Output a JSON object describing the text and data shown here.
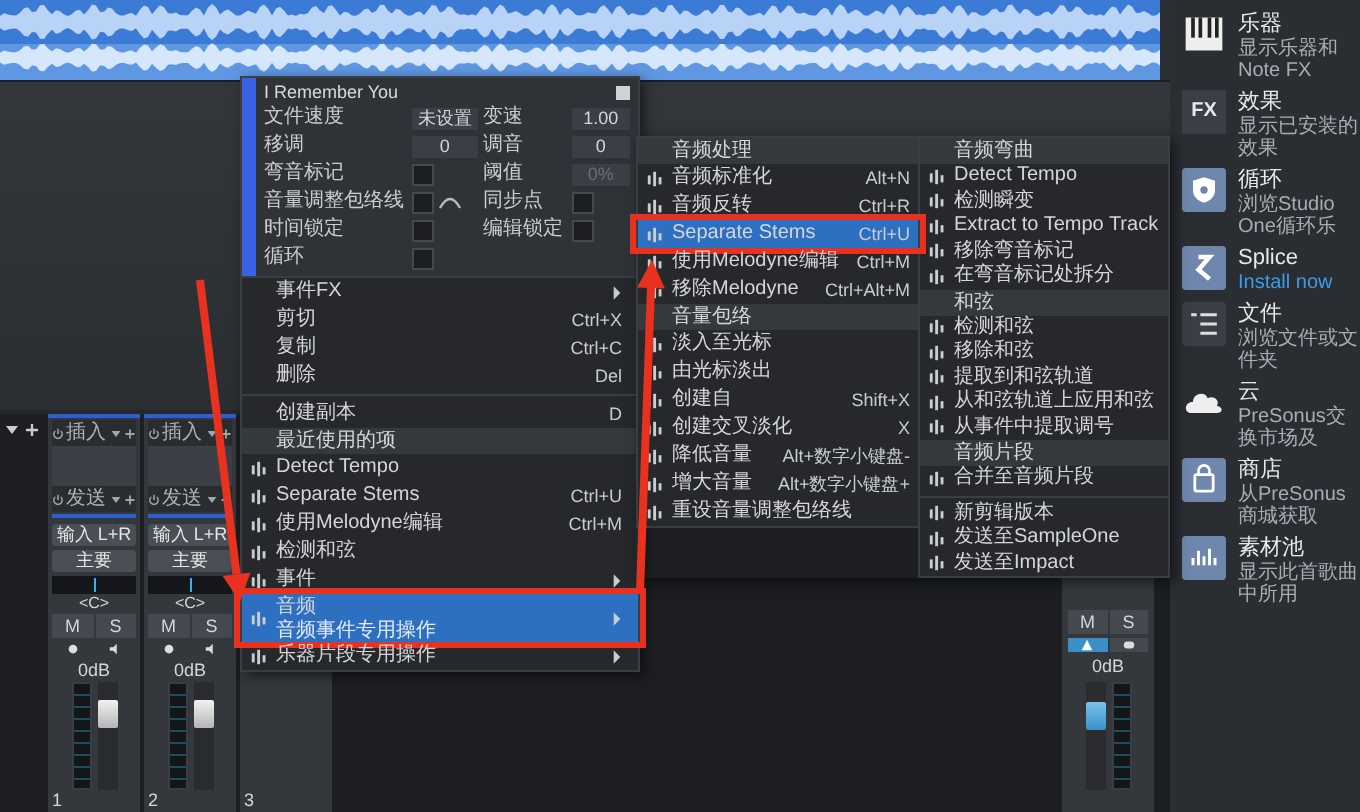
{
  "mixer": {
    "channels": [
      {
        "insert_label": "插入",
        "send_label": "发送",
        "input": "输入 L+R",
        "output": "主要",
        "pan": "<C>",
        "mute": "M",
        "solo": "S",
        "volume": "0dB",
        "level": 0.72,
        "number": "1"
      },
      {
        "insert_label": "插入",
        "send_label": "发送",
        "input": "输入 L+R",
        "output": "主要",
        "pan": "<C>",
        "mute": "M",
        "solo": "S",
        "volume": "0dB",
        "level": 0.72,
        "number": "2"
      },
      {
        "number": "3"
      }
    ],
    "right_channel": {
      "mute": "M",
      "solo": "S",
      "monitor_on": true,
      "volume": "0dB",
      "level": 0.7
    }
  },
  "event_menu": {
    "title": "I Remember You",
    "properties": [
      {
        "label": "文件速度",
        "kind": "value",
        "value": "未设置",
        "disabled": false
      },
      {
        "label": "变速",
        "kind": "value",
        "value": "1.00",
        "disabled": false
      },
      {
        "label": "移调",
        "kind": "value",
        "value": "0",
        "disabled": false
      },
      {
        "label": "调音",
        "kind": "value",
        "value": "0",
        "disabled": false
      },
      {
        "label": "弯音标记",
        "kind": "check",
        "checked": false
      },
      {
        "label": "阈值",
        "kind": "value",
        "value": "0%",
        "disabled": true
      },
      {
        "label": "音量调整包络线",
        "kind": "check_curve",
        "checked": false
      },
      {
        "label": "同步点",
        "kind": "check",
        "checked": false
      },
      {
        "label": "时间锁定",
        "kind": "check",
        "checked": false
      },
      {
        "label": "编辑锁定",
        "kind": "check",
        "checked": false
      },
      {
        "label": "循环",
        "kind": "check",
        "checked": false
      }
    ],
    "items": [
      {
        "kind": "item",
        "label": "事件FX",
        "submenu": true,
        "has_icon": false,
        "selected": false,
        "framed": false
      },
      {
        "kind": "item",
        "label": "剪切",
        "shortcut": "Ctrl+X",
        "submenu": false,
        "has_icon": false,
        "selected": false,
        "framed": false
      },
      {
        "kind": "item",
        "label": "复制",
        "shortcut": "Ctrl+C",
        "submenu": false,
        "has_icon": false,
        "selected": false,
        "framed": false
      },
      {
        "kind": "item",
        "label": "删除",
        "shortcut": "Del",
        "submenu": false,
        "has_icon": false,
        "selected": false,
        "framed": false
      },
      {
        "kind": "separator"
      },
      {
        "kind": "item",
        "label": "创建副本",
        "shortcut": "D",
        "submenu": false,
        "has_icon": false,
        "selected": false,
        "framed": false
      },
      {
        "kind": "section",
        "label": "最近使用的项"
      },
      {
        "kind": "item",
        "label": "Detect Tempo",
        "submenu": false,
        "has_icon": true,
        "selected": false,
        "framed": false
      },
      {
        "kind": "item",
        "label": "Separate Stems",
        "shortcut": "Ctrl+U",
        "submenu": false,
        "has_icon": true,
        "selected": false,
        "framed": false
      },
      {
        "kind": "item",
        "label": "使用Melodyne编辑",
        "shortcut": "Ctrl+M",
        "submenu": false,
        "has_icon": true,
        "selected": false,
        "framed": false
      },
      {
        "kind": "item",
        "label": "检测和弦",
        "submenu": false,
        "has_icon": true,
        "selected": false,
        "framed": false
      },
      {
        "kind": "item",
        "label": "事件",
        "submenu": true,
        "has_icon": true,
        "selected": false,
        "framed": false
      },
      {
        "kind": "item",
        "label": "音频",
        "subtitle": "音频事件专用操作",
        "submenu": true,
        "has_icon": true,
        "selected": true,
        "framed": true
      },
      {
        "kind": "item",
        "label": "乐器片段专用操作",
        "submenu": true,
        "has_icon": true,
        "selected": false,
        "framed": false
      }
    ]
  },
  "audio_submenu": {
    "columns": [
      [
        {
          "kind": "section",
          "label": "音频处理"
        },
        {
          "kind": "item",
          "label": "音频标准化",
          "shortcut": "Alt+N",
          "has_icon": true,
          "selected": false,
          "framed": false
        },
        {
          "kind": "item",
          "label": "音频反转",
          "shortcut": "Ctrl+R",
          "has_icon": true,
          "selected": false,
          "framed": false
        },
        {
          "kind": "item",
          "label": "Separate Stems",
          "shortcut": "Ctrl+U",
          "has_icon": true,
          "selected": true,
          "framed": true
        },
        {
          "kind": "item",
          "label": "使用Melodyne编辑",
          "shortcut": "Ctrl+M",
          "has_icon": true,
          "selected": false,
          "framed": false
        },
        {
          "kind": "item",
          "label": "移除Melodyne",
          "shortcut": "Ctrl+Alt+M",
          "has_icon": true,
          "selected": false,
          "framed": false
        },
        {
          "kind": "section",
          "label": "音量包络"
        },
        {
          "kind": "item",
          "label": "淡入至光标",
          "has_icon": true,
          "selected": false,
          "framed": false
        },
        {
          "kind": "item",
          "label": "由光标淡出",
          "has_icon": true,
          "selected": false,
          "framed": false
        },
        {
          "kind": "item",
          "label": "创建自",
          "shortcut": "Shift+X",
          "has_icon": true,
          "selected": false,
          "framed": false
        },
        {
          "kind": "item",
          "label": "创建交叉淡化",
          "shortcut": "X",
          "has_icon": true,
          "selected": false,
          "framed": false
        },
        {
          "kind": "item",
          "label": "降低音量",
          "shortcut": "Alt+数字小键盘-",
          "has_icon": true,
          "selected": false,
          "framed": false
        },
        {
          "kind": "item",
          "label": "增大音量",
          "shortcut": "Alt+数字小键盘+",
          "has_icon": true,
          "selected": false,
          "framed": false
        },
        {
          "kind": "item",
          "label": "重设音量调整包络线",
          "has_icon": true,
          "selected": false,
          "framed": false
        }
      ],
      [
        {
          "kind": "section",
          "label": "音频弯曲"
        },
        {
          "kind": "item",
          "label": "Detect Tempo",
          "has_icon": true,
          "selected": false,
          "framed": false
        },
        {
          "kind": "item",
          "label": "检测瞬变",
          "has_icon": true,
          "selected": false,
          "framed": false
        },
        {
          "kind": "item",
          "label": "Extract to Tempo Track",
          "has_icon": true,
          "selected": false,
          "framed": false
        },
        {
          "kind": "item",
          "label": "移除弯音标记",
          "has_icon": true,
          "selected": false,
          "framed": false
        },
        {
          "kind": "item",
          "label": "在弯音标记处拆分",
          "has_icon": true,
          "selected": false,
          "framed": false
        },
        {
          "kind": "section",
          "label": "和弦"
        },
        {
          "kind": "item",
          "label": "检测和弦",
          "has_icon": true,
          "selected": false,
          "framed": false
        },
        {
          "kind": "item",
          "label": "移除和弦",
          "has_icon": true,
          "selected": false,
          "framed": false
        },
        {
          "kind": "item",
          "label": "提取到和弦轨道",
          "has_icon": true,
          "selected": false,
          "framed": false
        },
        {
          "kind": "item",
          "label": "从和弦轨道上应用和弦",
          "has_icon": true,
          "selected": false,
          "framed": false
        },
        {
          "kind": "item",
          "label": "从事件中提取调号",
          "has_icon": true,
          "selected": false,
          "framed": false
        },
        {
          "kind": "section",
          "label": "音频片段"
        },
        {
          "kind": "item",
          "label": "合并至音频片段",
          "has_icon": true,
          "selected": false,
          "framed": false
        },
        {
          "kind": "separator"
        },
        {
          "kind": "item",
          "label": "新剪辑版本",
          "has_icon": true,
          "selected": false,
          "framed": false
        },
        {
          "kind": "item",
          "label": "发送至SampleOne",
          "has_icon": true,
          "selected": false,
          "framed": false
        },
        {
          "kind": "item",
          "label": "发送至Impact",
          "has_icon": true,
          "selected": false,
          "framed": false
        }
      ]
    ]
  },
  "browser": {
    "items": [
      {
        "title": "乐器",
        "subtitle": "显示乐器和Note FX",
        "kind": "text"
      },
      {
        "title": "效果",
        "subtitle": "显示已安装的效果",
        "kind": "text",
        "badge": "FX"
      },
      {
        "title": "循环",
        "subtitle": "浏览Studio One循环乐",
        "kind": "text"
      },
      {
        "title": "Splice",
        "subtitle": "Install now",
        "kind": "link"
      },
      {
        "title": "文件",
        "subtitle": "浏览文件或文件夹",
        "kind": "text"
      },
      {
        "title": "云",
        "subtitle": "PreSonus交换市场及",
        "kind": "text"
      },
      {
        "title": "商店",
        "subtitle": "从PreSonus商城获取",
        "kind": "text"
      },
      {
        "title": "素材池",
        "subtitle": "显示此首歌曲中所用",
        "kind": "text"
      }
    ]
  }
}
